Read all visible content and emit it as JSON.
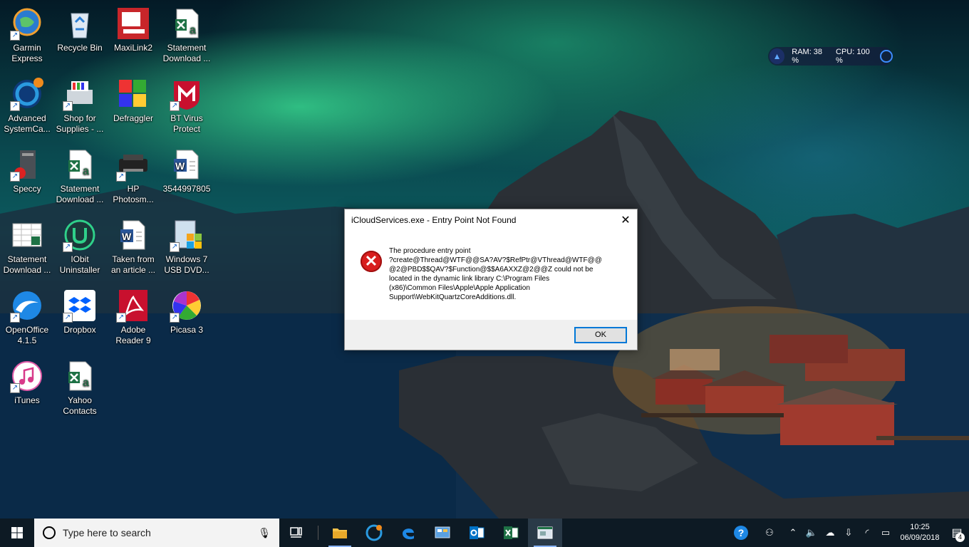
{
  "desktop": {
    "icons": [
      {
        "label": "Garmin\nExpress",
        "icon": "garmin-globe-icon",
        "shortcut": true
      },
      {
        "label": "Recycle Bin",
        "icon": "recycle-bin-icon",
        "shortcut": false
      },
      {
        "label": "MaxiLink2",
        "icon": "maxilink-icon",
        "shortcut": false
      },
      {
        "label": "Statement\nDownload ...",
        "icon": "excel-file-icon",
        "shortcut": false
      },
      {
        "label": "Advanced\nSystemCa...",
        "icon": "advanced-systemcare-icon",
        "shortcut": true
      },
      {
        "label": "Shop for\nSupplies - ...",
        "icon": "printer-icon",
        "shortcut": true
      },
      {
        "label": "Defraggler",
        "icon": "defraggler-icon",
        "shortcut": false
      },
      {
        "label": "BT Virus\nProtect",
        "icon": "mcafee-shield-icon",
        "shortcut": true
      },
      {
        "label": "Speccy",
        "icon": "speccy-icon",
        "shortcut": true
      },
      {
        "label": "Statement\nDownload ...",
        "icon": "excel-file-icon",
        "shortcut": false
      },
      {
        "label": "HP\nPhotosm...",
        "icon": "hp-printer-icon",
        "shortcut": true
      },
      {
        "label": "3544997805",
        "icon": "word-file-icon",
        "shortcut": false
      },
      {
        "label": "Statement\nDownload ...",
        "icon": "spreadsheet-thumbnail-icon",
        "shortcut": false
      },
      {
        "label": "IObit\nUninstaller",
        "icon": "iobit-uninstaller-icon",
        "shortcut": true
      },
      {
        "label": "Taken from\nan article ...",
        "icon": "word-file-icon",
        "shortcut": false
      },
      {
        "label": "Windows 7\nUSB DVD...",
        "icon": "windows-usb-dvd-icon",
        "shortcut": true
      },
      {
        "label": "OpenOffice\n4.1.5",
        "icon": "openoffice-icon",
        "shortcut": true
      },
      {
        "label": "Dropbox",
        "icon": "dropbox-icon",
        "shortcut": true
      },
      {
        "label": "Adobe\nReader 9",
        "icon": "adobe-reader-icon",
        "shortcut": true
      },
      {
        "label": "Picasa 3",
        "icon": "picasa-icon",
        "shortcut": true
      },
      {
        "label": "iTunes",
        "icon": "itunes-icon",
        "shortcut": true
      },
      {
        "label": "Yahoo\nContacts",
        "icon": "excel-file-icon",
        "shortcut": false
      }
    ]
  },
  "monitor": {
    "ram": "RAM: 38 %",
    "cpu": "CPU: 100 %"
  },
  "dialog": {
    "title": "iCloudServices.exe - Entry Point Not Found",
    "message": "The procedure entry point\n?create@Thread@WTF@@SA?AV?$RefPtr@VThread@WTF@@\n@2@PBD$$QAV?$Function@$$A6AXXZ@2@@Z could not be\nlocated in the dynamic link library C:\\Program Files\n(x86)\\Common Files\\Apple\\Apple Application\nSupport\\WebKitQuartzCoreAdditions.dll.",
    "ok_label": "OK",
    "icon": "error-icon"
  },
  "taskbar": {
    "search_placeholder": "Type here to search",
    "apps": [
      {
        "name": "task-view",
        "icon": "task-view-icon"
      },
      {
        "name": "file-explorer",
        "icon": "folder-icon"
      },
      {
        "name": "advanced-systemcare",
        "icon": "advanced-systemcare-icon"
      },
      {
        "name": "edge",
        "icon": "edge-icon"
      },
      {
        "name": "control-panel",
        "icon": "control-panel-icon"
      },
      {
        "name": "outlook",
        "icon": "outlook-icon"
      },
      {
        "name": "excel",
        "icon": "excel-icon"
      },
      {
        "name": "active-window",
        "icon": "window-icon"
      }
    ],
    "time": "10:25",
    "date": "06/09/2018",
    "notification_count": "4"
  },
  "colors": {
    "accent": "#0078d7",
    "error": "#d81e1e",
    "taskbar": "#0d1a24"
  }
}
